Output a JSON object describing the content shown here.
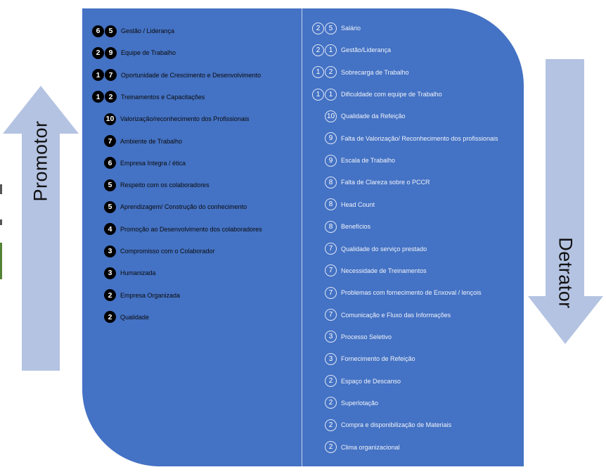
{
  "arrows": {
    "left_label": "Promotor",
    "right_label": "Detrator",
    "color": "#b4c3e2"
  },
  "panel": {
    "color": "#4472c4"
  },
  "promotor_items": [
    {
      "digits": [
        "6",
        "5"
      ],
      "label": "Gestão / Liderança"
    },
    {
      "digits": [
        "2",
        "9"
      ],
      "label": "Equipe de Trabalho"
    },
    {
      "digits": [
        "1",
        "7"
      ],
      "label": "Oportunidade de Crescimento e Desenvolvimento"
    },
    {
      "digits": [
        "1",
        "2"
      ],
      "label": "Treinamentos e Capacitações"
    },
    {
      "digits": [
        "10"
      ],
      "label": "Valorização/reconhecimento dos Profissionais"
    },
    {
      "digits": [
        "7"
      ],
      "label": "Ambiente de Trabalho"
    },
    {
      "digits": [
        "6"
      ],
      "label": "Empresa Integra / ética"
    },
    {
      "digits": [
        "5"
      ],
      "label": "Respeito com os colaboradores"
    },
    {
      "digits": [
        "5"
      ],
      "label": "Aprendizagem/ Construção do conhecimento"
    },
    {
      "digits": [
        "4"
      ],
      "label": "Promoção ao Desenvolvimento dos colaboradores"
    },
    {
      "digits": [
        "3"
      ],
      "label": "Compromisso com o Colaborador"
    },
    {
      "digits": [
        "3"
      ],
      "label": "Humanizada"
    },
    {
      "digits": [
        "2"
      ],
      "label": "Empresa Organizada"
    },
    {
      "digits": [
        "2"
      ],
      "label": "Qualidade"
    }
  ],
  "detrator_items": [
    {
      "digits": [
        "2",
        "5"
      ],
      "label": "Salário"
    },
    {
      "digits": [
        "2",
        "1"
      ],
      "label": "Gestão/Liderança"
    },
    {
      "digits": [
        "1",
        "2"
      ],
      "label": "Sobrecarga de Trabalho"
    },
    {
      "digits": [
        "1",
        "1"
      ],
      "label": "Dificuldade com equipe de Trabalho"
    },
    {
      "digits": [
        "10"
      ],
      "label": "Qualidade da Refeição"
    },
    {
      "digits": [
        "9"
      ],
      "label": "Falta de Valorização/ Reconhecimento dos profissionais"
    },
    {
      "digits": [
        "9"
      ],
      "label": "Escala de Trabalho"
    },
    {
      "digits": [
        "8"
      ],
      "label": "Falta de Clareza sobre o PCCR"
    },
    {
      "digits": [
        "8"
      ],
      "label": "Head Count"
    },
    {
      "digits": [
        "8"
      ],
      "label": "Benefícios"
    },
    {
      "digits": [
        "7"
      ],
      "label": "Qualidade do serviço prestado"
    },
    {
      "digits": [
        "7"
      ],
      "label": "Necessidade de Treinamentos"
    },
    {
      "digits": [
        "7"
      ],
      "label": "Problemas com fornecimento de Enxoval / lençois"
    },
    {
      "digits": [
        "7"
      ],
      "label": "Comunicação e Fluxo das Informações"
    },
    {
      "digits": [
        "3"
      ],
      "label": "Processo Seletivo"
    },
    {
      "digits": [
        "3"
      ],
      "label": "Fornecimento de Refeição"
    },
    {
      "digits": [
        "2"
      ],
      "label": "Espaço de Descanso"
    },
    {
      "digits": [
        "2"
      ],
      "label": "Superlotação"
    },
    {
      "digits": [
        "2"
      ],
      "label": "Compra e disponibilização de Materiais"
    },
    {
      "digits": [
        "2"
      ],
      "label": "Clima organizacional"
    }
  ]
}
